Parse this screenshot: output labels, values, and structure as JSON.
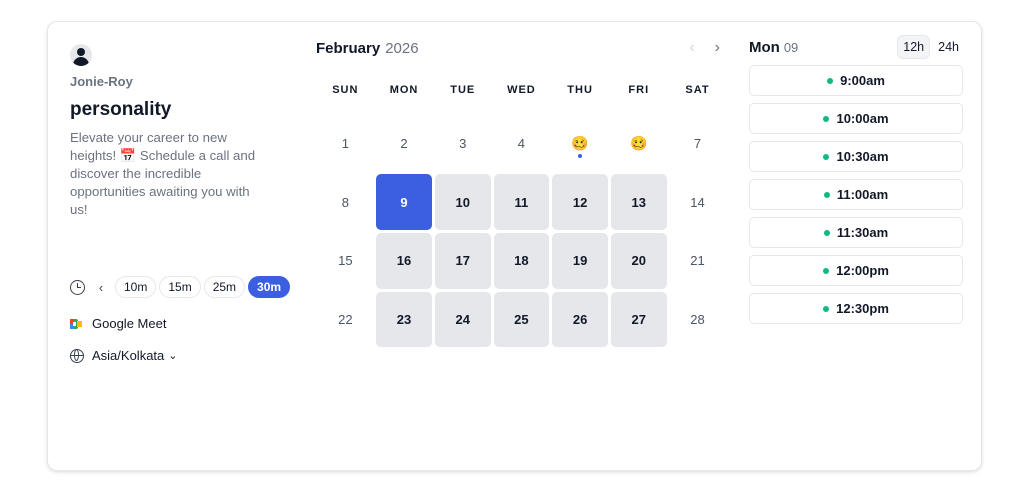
{
  "profile": {
    "owner": "Jonie-Roy",
    "title": "personality",
    "description": "Elevate your career to new heights! 📅 Schedule a call and discover the incredible opportunities awaiting you with us!"
  },
  "durations": {
    "prev_icon": "‹",
    "options": [
      "10m",
      "15m",
      "25m",
      "30m"
    ],
    "selected": "30m"
  },
  "location": {
    "label": "Google Meet"
  },
  "timezone": {
    "label": "Asia/Kolkata",
    "chevron": "⌄"
  },
  "calendar": {
    "month": "February",
    "year": "2026",
    "prev_icon": "‹",
    "next_icon": "›",
    "weekdays": [
      "SUN",
      "MON",
      "TUE",
      "WED",
      "THU",
      "FRI",
      "SAT"
    ],
    "weeks": [
      [
        {
          "label": "1",
          "state": "plain"
        },
        {
          "label": "2",
          "state": "plain"
        },
        {
          "label": "3",
          "state": "plain"
        },
        {
          "label": "4",
          "state": "plain"
        },
        {
          "label": "🥴",
          "state": "emoji",
          "dot": true
        },
        {
          "label": "🥴",
          "state": "emoji"
        },
        {
          "label": "7",
          "state": "plain"
        }
      ],
      [
        {
          "label": "8",
          "state": "plain"
        },
        {
          "label": "9",
          "state": "selected"
        },
        {
          "label": "10",
          "state": "avail"
        },
        {
          "label": "11",
          "state": "avail"
        },
        {
          "label": "12",
          "state": "avail"
        },
        {
          "label": "13",
          "state": "avail"
        },
        {
          "label": "14",
          "state": "plain"
        }
      ],
      [
        {
          "label": "15",
          "state": "plain"
        },
        {
          "label": "16",
          "state": "avail"
        },
        {
          "label": "17",
          "state": "avail"
        },
        {
          "label": "18",
          "state": "avail"
        },
        {
          "label": "19",
          "state": "avail"
        },
        {
          "label": "20",
          "state": "avail"
        },
        {
          "label": "21",
          "state": "plain"
        }
      ],
      [
        {
          "label": "22",
          "state": "plain"
        },
        {
          "label": "23",
          "state": "avail"
        },
        {
          "label": "24",
          "state": "avail"
        },
        {
          "label": "25",
          "state": "avail"
        },
        {
          "label": "26",
          "state": "avail"
        },
        {
          "label": "27",
          "state": "avail"
        },
        {
          "label": "28",
          "state": "plain"
        }
      ]
    ]
  },
  "times": {
    "day_name": "Mon",
    "day_num": "09",
    "format_12h": "12h",
    "format_24h": "24h",
    "slots": [
      "9:00am",
      "10:00am",
      "10:30am",
      "11:00am",
      "11:30am",
      "12:00pm",
      "12:30pm"
    ]
  },
  "colors": {
    "accent": "#3b5fe0",
    "available_bg": "#e5e7eb",
    "slot_dot": "#10b981"
  },
  "icons": {
    "avatar": "user-avatar-icon",
    "clock": "clock-icon",
    "meet": "google-meet-icon",
    "globe": "globe-icon"
  }
}
